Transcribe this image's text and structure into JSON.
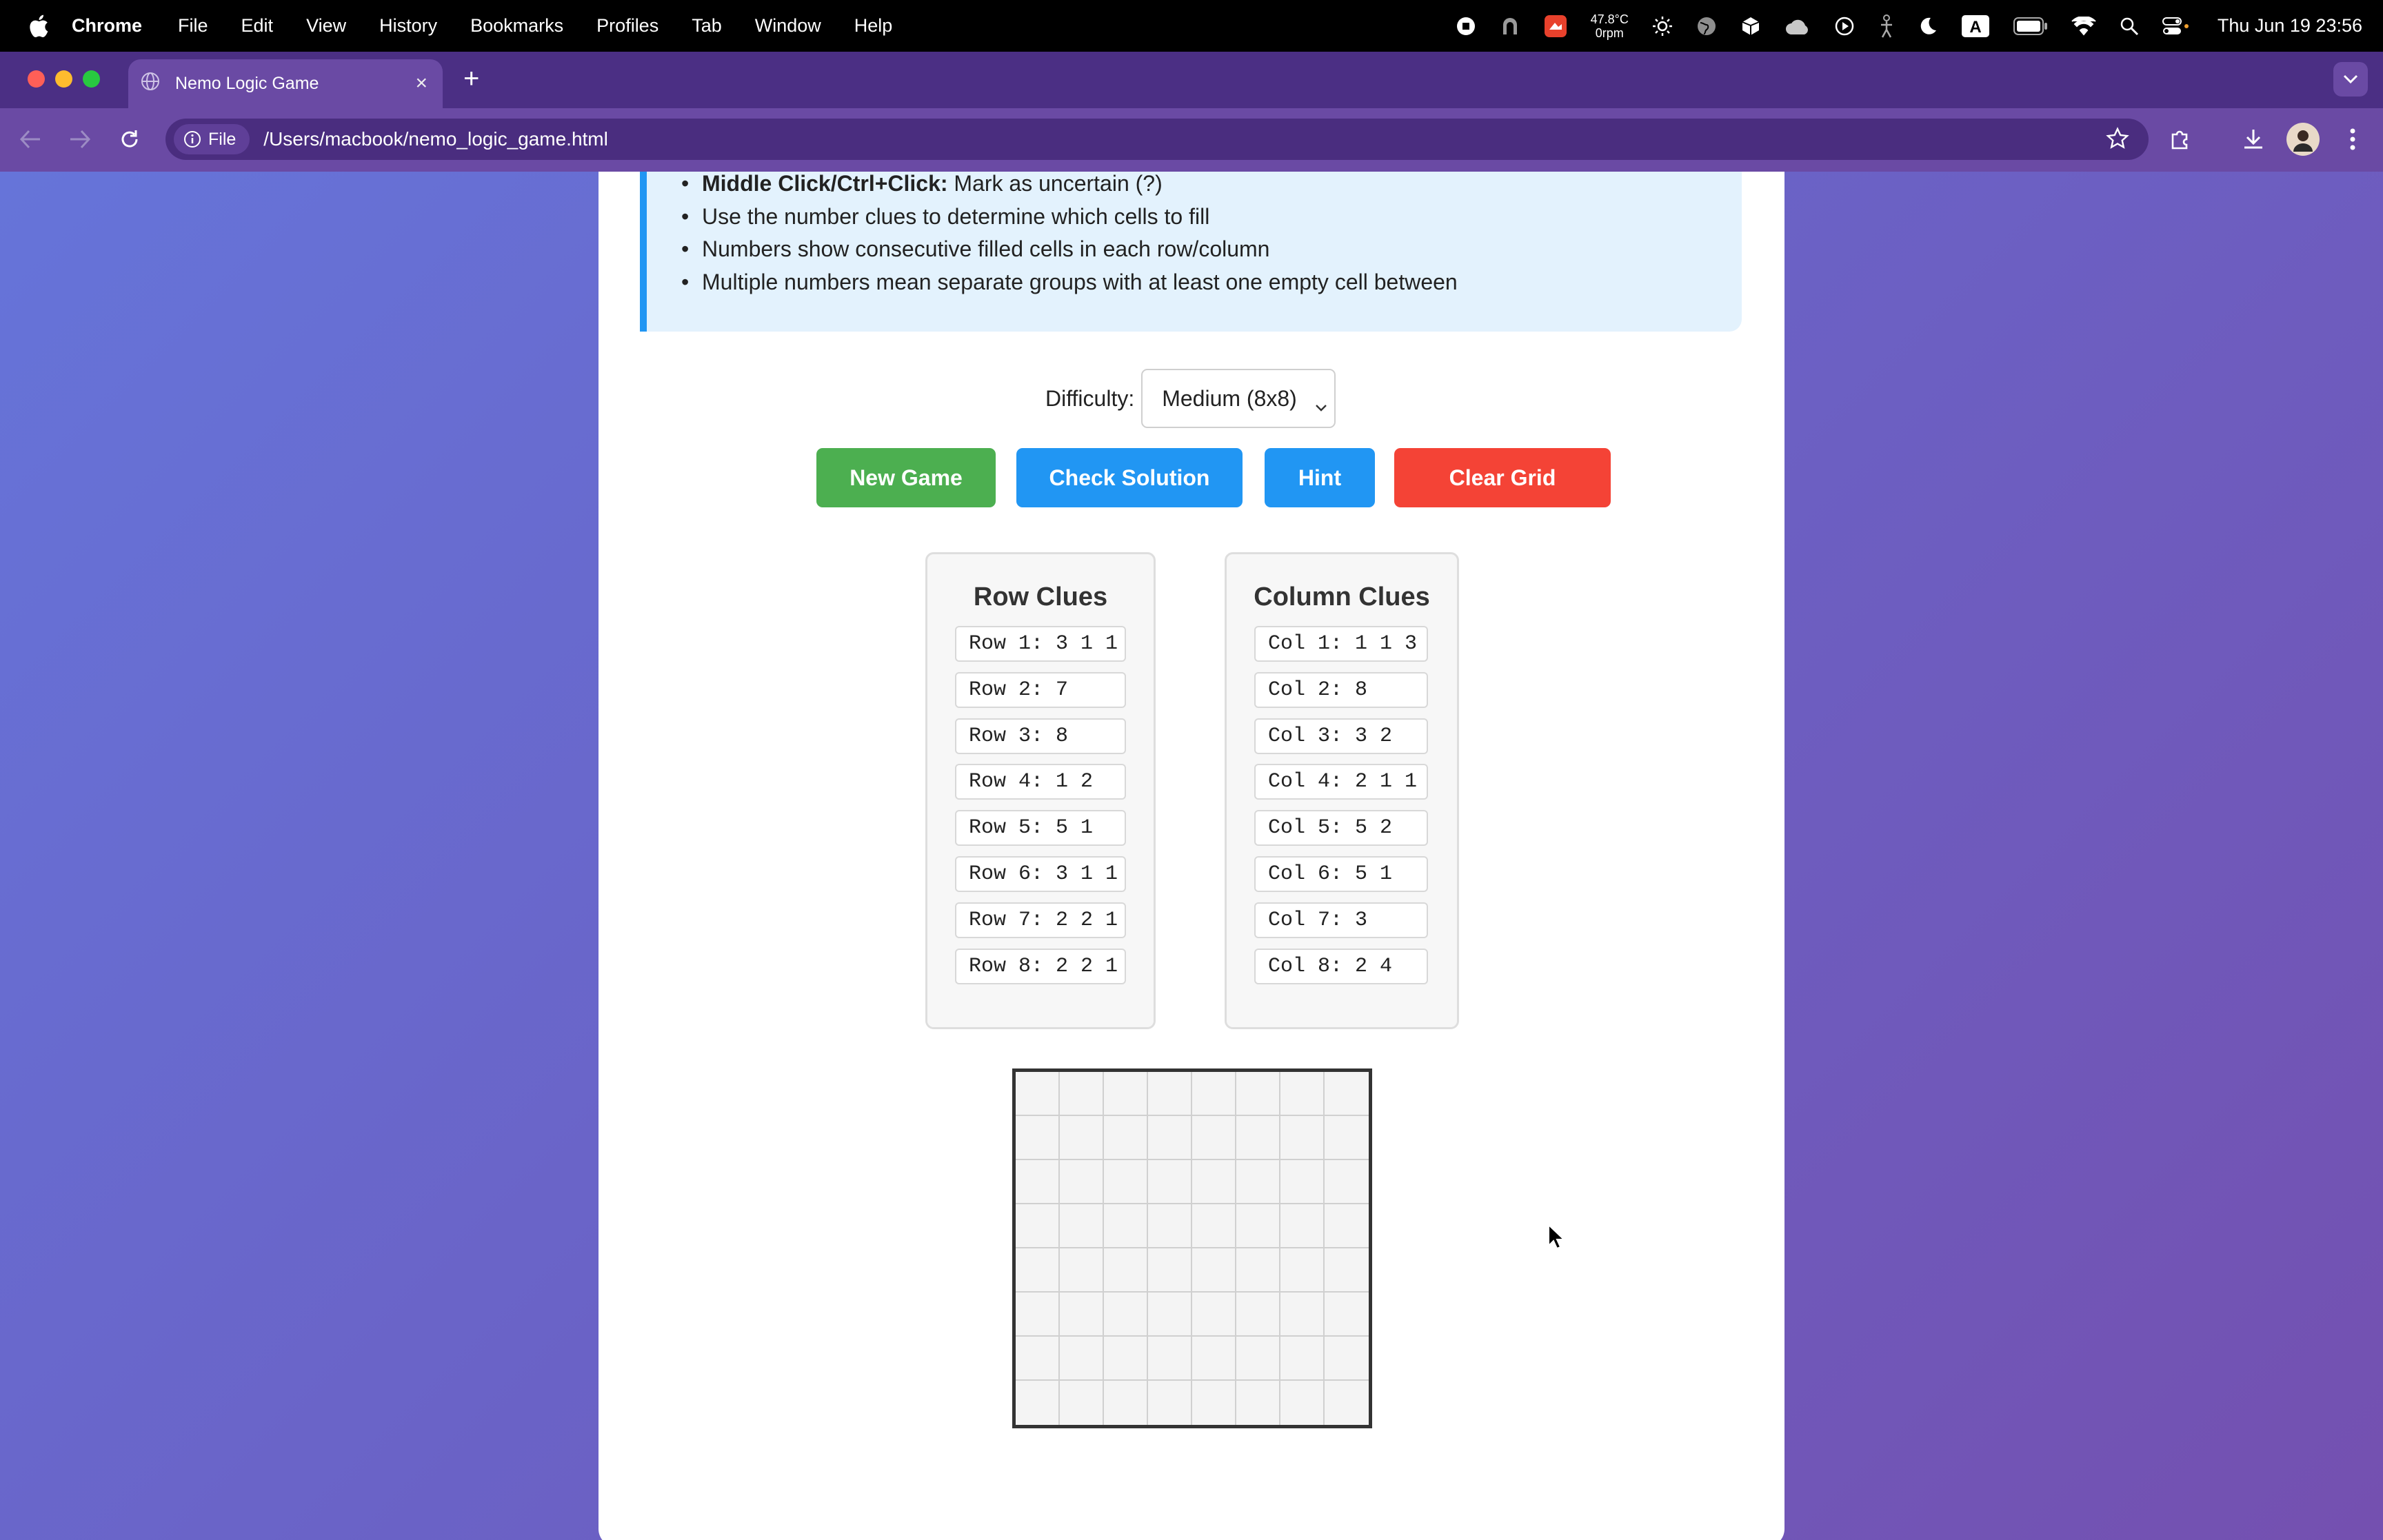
{
  "menubar": {
    "app_name": "Chrome",
    "items": [
      "File",
      "Edit",
      "View",
      "History",
      "Bookmarks",
      "Profiles",
      "Tab",
      "Window",
      "Help"
    ],
    "weather": {
      "temp": "47.8°C",
      "rpm": "0rpm"
    },
    "input_badge": "A",
    "clock": "Thu Jun 19  23:56"
  },
  "browser": {
    "tab_title": "Nemo Logic Game",
    "file_chip": "File",
    "url": "/Users/macbook/nemo_logic_game.html"
  },
  "instructions": {
    "line1_bold": "Middle Click/Ctrl+Click:",
    "line1_rest": " Mark as uncertain (?)",
    "line2": "Use the number clues to determine which cells to fill",
    "line3": "Numbers show consecutive filled cells in each row/column",
    "line4": "Multiple numbers mean separate groups with at least one empty cell between"
  },
  "difficulty": {
    "label": "Difficulty:",
    "selected": "Medium (8x8)"
  },
  "buttons": {
    "new_game": "New Game",
    "check": "Check Solution",
    "hint": "Hint",
    "clear": "Clear Grid"
  },
  "row_clues": {
    "title": "Row Clues",
    "items": [
      "Row 1: 3 1 1",
      "Row 2: 7",
      "Row 3: 8",
      "Row 4: 1 2",
      "Row 5: 5 1",
      "Row 6: 3 1 1",
      "Row 7: 2 2 1",
      "Row 8: 2 2 1"
    ]
  },
  "col_clues": {
    "title": "Column Clues",
    "items": [
      "Col 1: 1 1 3",
      "Col 2: 8",
      "Col 3: 3 2",
      "Col 4: 2 1 1",
      "Col 5: 5 2",
      "Col 6: 5 1",
      "Col 7: 3",
      "Col 8: 2 4"
    ]
  },
  "grid": {
    "size": 8,
    "filled_cells": 0
  },
  "colors": {
    "green": "#4caf50",
    "blue": "#2196f3",
    "red": "#f44336",
    "info_bg": "#e3f2fd"
  }
}
